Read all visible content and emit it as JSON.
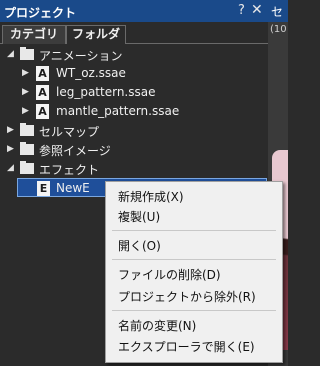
{
  "panel": {
    "title": "プロジェクト",
    "help_glyph": "?",
    "close_glyph": "✕"
  },
  "tabs": [
    {
      "label": "カテゴリ",
      "active": true
    },
    {
      "label": "フォルダ",
      "active": false
    }
  ],
  "tree": {
    "expanded_glyph": "◢",
    "collapsed_glyph": "▶",
    "items": [
      {
        "label": "アニメーション",
        "type": "folder",
        "expanded": true
      },
      {
        "label": "WT_oz.ssae",
        "type": "file",
        "icon_letter": "A"
      },
      {
        "label": "leg_pattern.ssae",
        "type": "file",
        "icon_letter": "A"
      },
      {
        "label": "mantle_pattern.ssae",
        "type": "file",
        "icon_letter": "A"
      },
      {
        "label": "セルマップ",
        "type": "folder",
        "expanded": false
      },
      {
        "label": "参照イメージ",
        "type": "folder",
        "expanded": false
      },
      {
        "label": "エフェクト",
        "type": "folder",
        "expanded": true
      },
      {
        "label": "NewE",
        "type": "file",
        "icon_letter": "E",
        "selected": true
      }
    ]
  },
  "right_pane": {
    "title": "セ",
    "subtitle": "(10"
  },
  "context_menu": {
    "items": [
      "新規作成(X)",
      "複製(U)",
      "開く(O)",
      "ファイルの削除(D)",
      "プロジェクトから除外(R)",
      "名前の変更(N)",
      "エクスプローラで開く(E)"
    ]
  },
  "colors": {
    "titlebar": "#1a4a8a",
    "background": "#2b2b2b",
    "selection": "#1f4f9a",
    "menu_bg": "#f0f0f0"
  }
}
